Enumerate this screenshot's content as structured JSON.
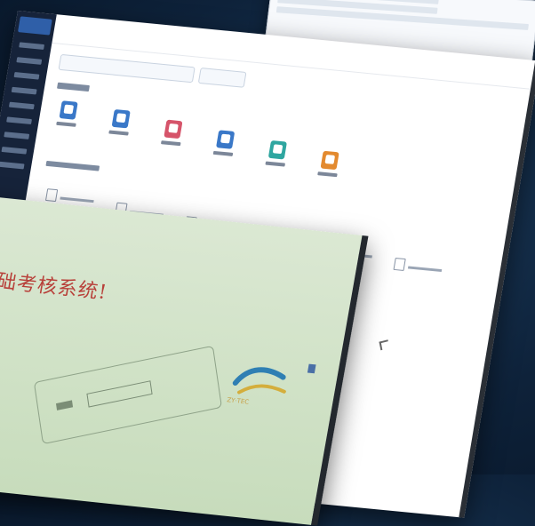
{
  "front_screen": {
    "title": "基础考核系统!",
    "logo_text": "ZY·TEC"
  },
  "colors": {
    "background": "#0e223a",
    "sidebar": "#16233a",
    "front_panel": "#cfe1c5",
    "title_red": "#b8403a",
    "icon_blue": "#3a78c8",
    "icon_red": "#d6546a",
    "icon_teal": "#2fa6a0",
    "icon_orange": "#e38a2f"
  },
  "icons": [
    "app-icon-blue",
    "app-icon-blue-2",
    "app-icon-red",
    "app-icon-blue-3",
    "app-icon-teal",
    "app-icon-orange"
  ]
}
